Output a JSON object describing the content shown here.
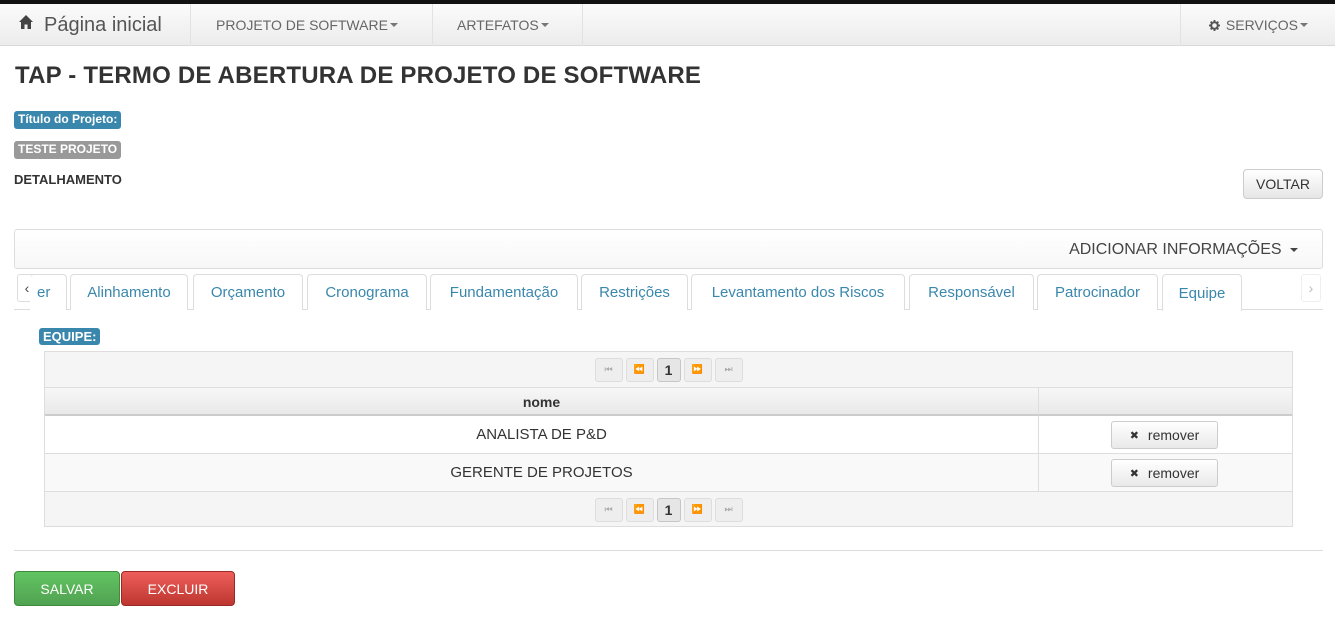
{
  "navbar": {
    "home_label": "Página inicial",
    "menu": [
      "PROJETO DE SOFTWARE",
      "ARTEFATOS"
    ],
    "services_label": "SERVIÇOS"
  },
  "page": {
    "title": "TAP - TERMO DE ABERTURA DE PROJETO DE SOFTWARE",
    "project_title_label": "Título do Projeto:",
    "project_title_value": "TESTE PROJETO",
    "detail_label": "DETALHAMENTO",
    "back_button": "VOLTAR",
    "add_info": "ADICIONAR INFORMAÇÕES"
  },
  "tabs": {
    "partial_first": "er",
    "items": [
      "Alinhamento",
      "Orçamento",
      "Cronograma",
      "Fundamentação",
      "Restrições",
      "Levantamento dos Riscos",
      "Responsável",
      "Patrocinador",
      "Equipe"
    ],
    "active": "Equipe",
    "scroll_left": "‹",
    "scroll_right": "›"
  },
  "team": {
    "section_label": "EQUIPE:",
    "column_header": "nome",
    "current_page": "1",
    "pager_icons": [
      "first-page-icon",
      "prev-page-icon",
      "next-page-icon",
      "last-page-icon"
    ],
    "pager_glyphs": [
      "⏮",
      "⏪",
      "⏩",
      "⏭"
    ],
    "rows": [
      {
        "nome": "ANALISTA DE P&D",
        "action": "remover"
      },
      {
        "nome": "GERENTE DE PROJETOS",
        "action": "remover"
      }
    ]
  },
  "footer": {
    "save": "SALVAR",
    "delete": "EXCLUIR"
  },
  "colors": {
    "info": "#3a87ad",
    "success": "#5bb75b",
    "danger": "#da4f49"
  }
}
